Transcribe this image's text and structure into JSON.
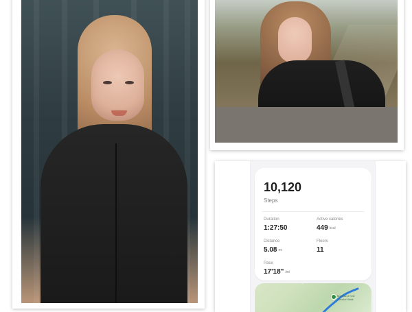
{
  "fitness": {
    "steps_value": "10,120",
    "steps_label": "Steps",
    "duration_label": "Duration",
    "duration_value": "1:27:50",
    "calories_label": "Active calories",
    "calories_value": "449",
    "calories_unit": "kcal",
    "distance_label": "Distance",
    "distance_value": "5.08",
    "distance_unit": "mi",
    "floors_label": "Floors",
    "floors_value": "11",
    "pace_label": "Pace",
    "pace_value": "17'18\"",
    "pace_unit": "/mi"
  },
  "map": {
    "caption": "Moorland Trail Circular Walk"
  },
  "colors": {
    "card_background": "#ffffff",
    "jacket_black": "#1f1f1f",
    "map_green": "#cfe1bd",
    "route_blue": "#2e7bd9"
  }
}
